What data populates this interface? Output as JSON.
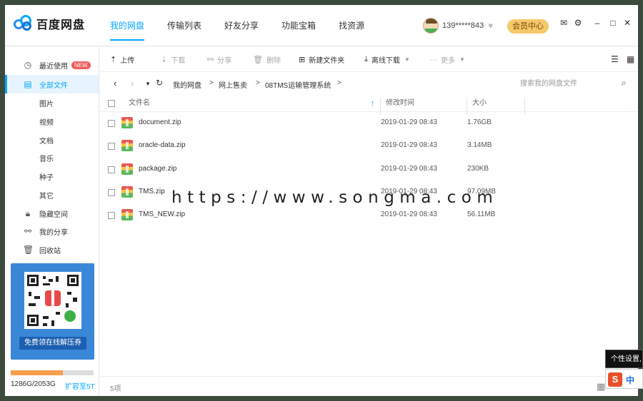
{
  "app": {
    "name": "百度网盘",
    "nav": [
      "我的网盘",
      "传输列表",
      "好友分享",
      "功能宝箱",
      "找资源"
    ],
    "active_nav": 0,
    "user": "139*****843",
    "vip_button": "会员中心"
  },
  "sidebar": {
    "items": [
      {
        "label": "最近使用",
        "badge": "NEW",
        "icon": "clock-icon"
      },
      {
        "label": "全部文件",
        "icon": "file-icon",
        "active": true
      },
      {
        "label": "图片"
      },
      {
        "label": "视频"
      },
      {
        "label": "文档"
      },
      {
        "label": "音乐"
      },
      {
        "label": "种子"
      },
      {
        "label": "其它"
      },
      {
        "label": "隐藏空间",
        "icon": "lock-icon"
      },
      {
        "label": "我的分享",
        "icon": "share-icon"
      },
      {
        "label": "回收站",
        "icon": "trash-icon"
      }
    ],
    "promo_button": "免费领在线解压券",
    "quota_text": "1286G/2053G",
    "quota_fraction": 0.626,
    "expand_link": "扩容至5T"
  },
  "toolbar": {
    "upload": "上传",
    "download": "下载",
    "share": "分享",
    "delete": "删除",
    "new_folder": "新建文件夹",
    "offline_download": "离线下载",
    "more": "更多"
  },
  "path": {
    "crumbs": [
      "我的网盘",
      "网上售卖",
      "08TMS运输管理系统"
    ],
    "search_placeholder": "搜索我的网盘文件"
  },
  "list": {
    "headers": {
      "name": "文件名",
      "modified": "修改时间",
      "size": "大小"
    },
    "rows": [
      {
        "name": "document.zip",
        "modified": "2019-01-29 08:43",
        "size": "1.76GB"
      },
      {
        "name": "oracle-data.zip",
        "modified": "2019-01-29 08:43",
        "size": "3.14MB"
      },
      {
        "name": "package.zip",
        "modified": "2019-01-29 08:43",
        "size": "230KB"
      },
      {
        "name": "TMS.zip",
        "modified": "2019-01-29 08:43",
        "size": "97.09MB"
      },
      {
        "name": "TMS_NEW.zip",
        "modified": "2019-01-29 08:43",
        "size": "56.11MB"
      }
    ]
  },
  "status": {
    "count": "5项"
  },
  "overlay": {
    "watermark": "https://www.songma.com",
    "ime_tip": "个性设置,",
    "ime_logo": "S",
    "ime_mode": "中"
  },
  "colors": {
    "accent": "#06a7ff",
    "vip": "#f5c86a",
    "promo": "#3a87d8",
    "quota": "#f6a04d"
  }
}
